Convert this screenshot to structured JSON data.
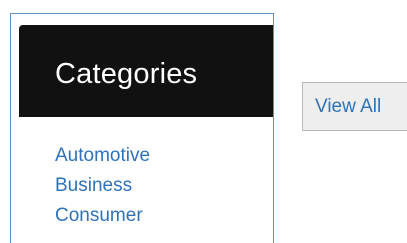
{
  "categories_panel": {
    "title": "Categories",
    "items": [
      {
        "label": "Automotive"
      },
      {
        "label": "Business"
      },
      {
        "label": "Consumer"
      }
    ],
    "link_color": "#2f72b8",
    "header_bg": "#111111",
    "border_color": "#5f8fbf"
  },
  "view_all_button": {
    "label": "View All",
    "bg": "#eeeeee"
  }
}
